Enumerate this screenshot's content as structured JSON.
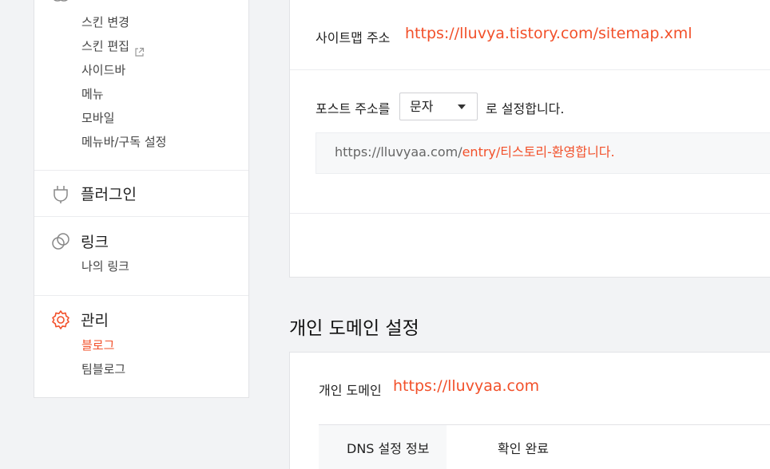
{
  "sidebar": {
    "skin": {
      "sub": [
        {
          "label": "스킨 변경"
        },
        {
          "label": "스킨 편집"
        },
        {
          "label": "사이드바"
        },
        {
          "label": "메뉴"
        },
        {
          "label": "모바일"
        },
        {
          "label": "메뉴바/구독 설정"
        }
      ]
    },
    "plugin": {
      "label": "플러그인"
    },
    "link": {
      "label": "링크",
      "sub": [
        {
          "label": "나의 링크"
        }
      ]
    },
    "manage": {
      "label": "관리",
      "sub": [
        {
          "label": "블로그"
        },
        {
          "label": "팀블로그"
        }
      ]
    }
  },
  "sitemap": {
    "label": "사이트맵 주소",
    "url": "https://lluvya.tistory.com/sitemap.xml"
  },
  "post_address": {
    "prefix": "포스트 주소를",
    "select_value": "문자",
    "suffix": "로 설정합니다.",
    "preview_base": "https://lluvyaa.com/",
    "preview_path": "entry/티스토리-환영합니다."
  },
  "custom_domain": {
    "section_title": "개인 도메인 설정",
    "label": "개인 도메인",
    "url": "https://lluvyaa.com",
    "dns_header": "DNS 설정 정보",
    "dns_status": "확인 완료"
  },
  "colors": {
    "accent": "#f2502a",
    "background": "#f2f3f5"
  }
}
